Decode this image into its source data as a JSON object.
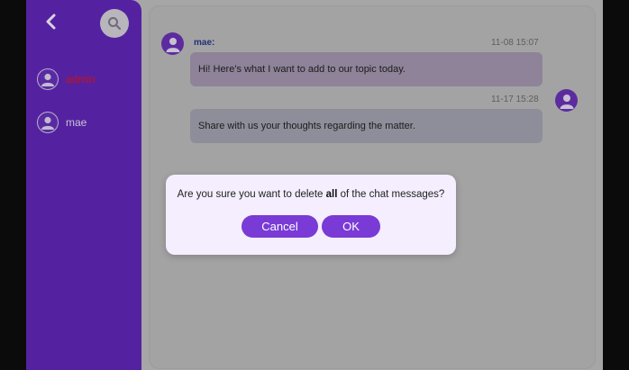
{
  "sidebar": {
    "users": [
      {
        "name": "admin",
        "color": "#cc1111"
      },
      {
        "name": "mae",
        "color": "#c9c4d4"
      }
    ]
  },
  "messages": [
    {
      "sender": "mae:",
      "time": "11-08 15:07",
      "text": "Hi! Here's what I want to add to our topic today.",
      "direction": "incoming"
    },
    {
      "sender": "",
      "time": "11-17 15:28",
      "text": "Share with us your thoughts regarding the matter.",
      "direction": "outgoing"
    }
  ],
  "dialog": {
    "prefix": "Are you sure you want to delete ",
    "emphasis": "all",
    "suffix": " of the chat messages?",
    "cancel_label": "Cancel",
    "ok_label": "OK"
  },
  "colors": {
    "sidebar": "#5422a0",
    "accent": "#7a3ad6",
    "overlay": "#a6a6a6",
    "dialog": "#f4eefe"
  },
  "icons": {
    "back": "chevron-left-icon",
    "search": "search-icon",
    "avatar": "user-avatar-icon"
  }
}
